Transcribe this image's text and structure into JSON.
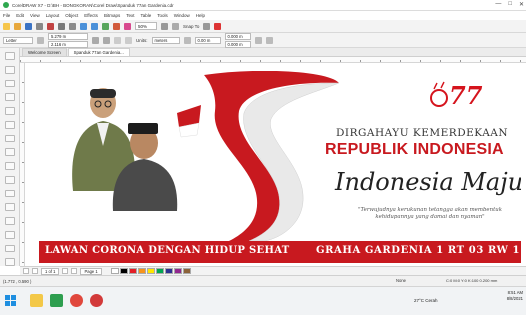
{
  "window": {
    "title": "CorelDRAW X7 - D:\\BH - BONGKORAN\\Corel Draw\\Spanduk 77an Gardenia.cdr",
    "controls": [
      "—",
      "□",
      "✕"
    ]
  },
  "menu": [
    "File",
    "Edit",
    "View",
    "Layout",
    "Object",
    "Effects",
    "Bitmaps",
    "Text",
    "Table",
    "Tools",
    "Window",
    "Help"
  ],
  "toolbar": {
    "zoom": "50%",
    "snap_label": "Snap To"
  },
  "property_bar": {
    "preset": "Letter",
    "width": "5.279 m",
    "height": "2.116 m",
    "units_label": "Units:",
    "units": "meters",
    "nudge": "0.00 m",
    "dup_x": "0.000 m",
    "dup_y": "0.000 m"
  },
  "tabs": [
    {
      "label": "Welcome Screen",
      "active": false
    },
    {
      "label": "Spanduk 77an Gardenia...",
      "active": true
    }
  ],
  "banner": {
    "line1": "DIRGAHAYU KEMERDEKAAN",
    "line2": "REPUBLIK INDONESIA",
    "line3": "Indonesia Maju",
    "quote": "\"Terwujudnya kerukunan tetangga akan membentuk kehidupannya yang damai dan nyaman\"",
    "logo": "77",
    "bottom_left": "LAWAN CORONA DENGAN HIDUP SEHAT",
    "bottom_right": "GRAHA GARDENIA 1 RT 03 RW 11",
    "colors": {
      "red": "#c8191f",
      "white": "#ffffff"
    }
  },
  "doc_nav": {
    "page_count": "1 of 1",
    "page_tab": "Page 1"
  },
  "palette": [
    "#ffffff",
    "#000000",
    "#e41e26",
    "#f7941d",
    "#ffe600",
    "#00a651",
    "#2e3192",
    "#92278f",
    "#8c6239"
  ],
  "status": {
    "coords": "(1.772 , 0.590 )",
    "fill": "None",
    "color_info": "C:0 M:0 Y:0 K:100 0.200 mm"
  },
  "taskbar": {
    "weather": "27°C  Cerah",
    "time": "8:51 AM",
    "date": "8/8/2021"
  }
}
